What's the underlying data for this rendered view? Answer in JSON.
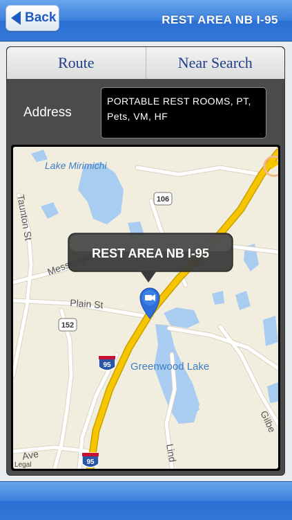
{
  "nav": {
    "back_label": "Back",
    "title": "REST AREA NB I-95"
  },
  "tabs": [
    {
      "label": "Route"
    },
    {
      "label": "Near Search"
    }
  ],
  "address": {
    "label": "Address",
    "value": "PORTABLE REST ROOMS, PT, Pets,  VM, HF"
  },
  "map": {
    "callout": "REST AREA NB I-95",
    "labels": {
      "lake1": "Lake Mirimichi",
      "lake2": "Greenwood Lake",
      "taunton": "Taunton St",
      "messenger": "Messenger St",
      "plain": "Plain St",
      "gilbert": "Gilbe",
      "lind": "Lind",
      "ave": "Ave",
      "legal": "Legal"
    },
    "shields": {
      "route106": "106",
      "route152": "152",
      "i95_top": "95",
      "i95_bottom": "95"
    },
    "colors": {
      "land": "#f2eedf",
      "water": "#a9cdf0",
      "highway": "#f5c500",
      "road": "#ffffff",
      "pin": "#2f6ed8"
    }
  }
}
